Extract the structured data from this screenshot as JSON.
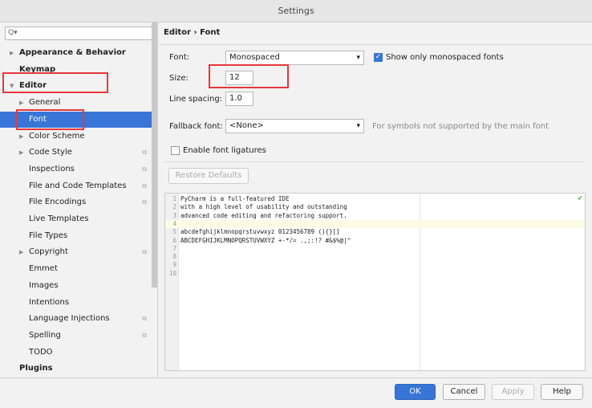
{
  "window": {
    "title": "Settings"
  },
  "sidebar": {
    "search_placeholder": "Q▾",
    "items": [
      {
        "label": "Appearance & Behavior",
        "level": 0,
        "arrow": "▶",
        "bold": true
      },
      {
        "label": "Keymap",
        "level": 0,
        "bold": true
      },
      {
        "label": "Editor",
        "level": 0,
        "arrow": "▼",
        "bold": true
      },
      {
        "label": "General",
        "level": 1,
        "arrow": "▶"
      },
      {
        "label": "Font",
        "level": 1,
        "selected": true
      },
      {
        "label": "Color Scheme",
        "level": 1,
        "arrow": "▶"
      },
      {
        "label": "Code Style",
        "level": 1,
        "arrow": "▶",
        "copy": true
      },
      {
        "label": "Inspections",
        "level": 1,
        "copy": true
      },
      {
        "label": "File and Code Templates",
        "level": 1,
        "copy": true
      },
      {
        "label": "File Encodings",
        "level": 1,
        "copy": true
      },
      {
        "label": "Live Templates",
        "level": 1
      },
      {
        "label": "File Types",
        "level": 1
      },
      {
        "label": "Copyright",
        "level": 1,
        "arrow": "▶",
        "copy": true
      },
      {
        "label": "Emmet",
        "level": 1
      },
      {
        "label": "Images",
        "level": 1
      },
      {
        "label": "Intentions",
        "level": 1
      },
      {
        "label": "Language Injections",
        "level": 1,
        "copy": true
      },
      {
        "label": "Spelling",
        "level": 1,
        "copy": true
      },
      {
        "label": "TODO",
        "level": 1
      },
      {
        "label": "Plugins",
        "level": 0,
        "bold": true
      }
    ]
  },
  "main": {
    "breadcrumb": "Editor  ›  Font",
    "font_label": "Font:",
    "font_value": "Monospaced",
    "monospaced_only_label": "Show only monospaced fonts",
    "monospaced_only": true,
    "size_label": "Size:",
    "size_value": "12",
    "line_spacing_label": "Line spacing:",
    "line_spacing_value": "1.0",
    "fallback_label": "Fallback font:",
    "fallback_value": "<None>",
    "fallback_hint": "For symbols not supported by the main font",
    "ligatures_label": "Enable font ligatures",
    "ligatures": false,
    "restore_defaults": "Restore Defaults",
    "preview_lines": [
      "PyCharm is a full-featured IDE",
      "with a high level of usability and outstanding",
      "advanced code editing and refactoring support.",
      "",
      "abcdefghijklmnopqrstuvwxyz 0123456789 (){}[]",
      "ABCDEFGHIJKLMNOPQRSTUVWXYZ +-*/= .,;:!? #&$%@|^",
      "",
      "",
      "",
      ""
    ]
  },
  "footer": {
    "ok": "OK",
    "cancel": "Cancel",
    "apply": "Apply",
    "help": "Help"
  },
  "colors": {
    "accent": "#3875d7",
    "annotation": "#e8373b"
  }
}
